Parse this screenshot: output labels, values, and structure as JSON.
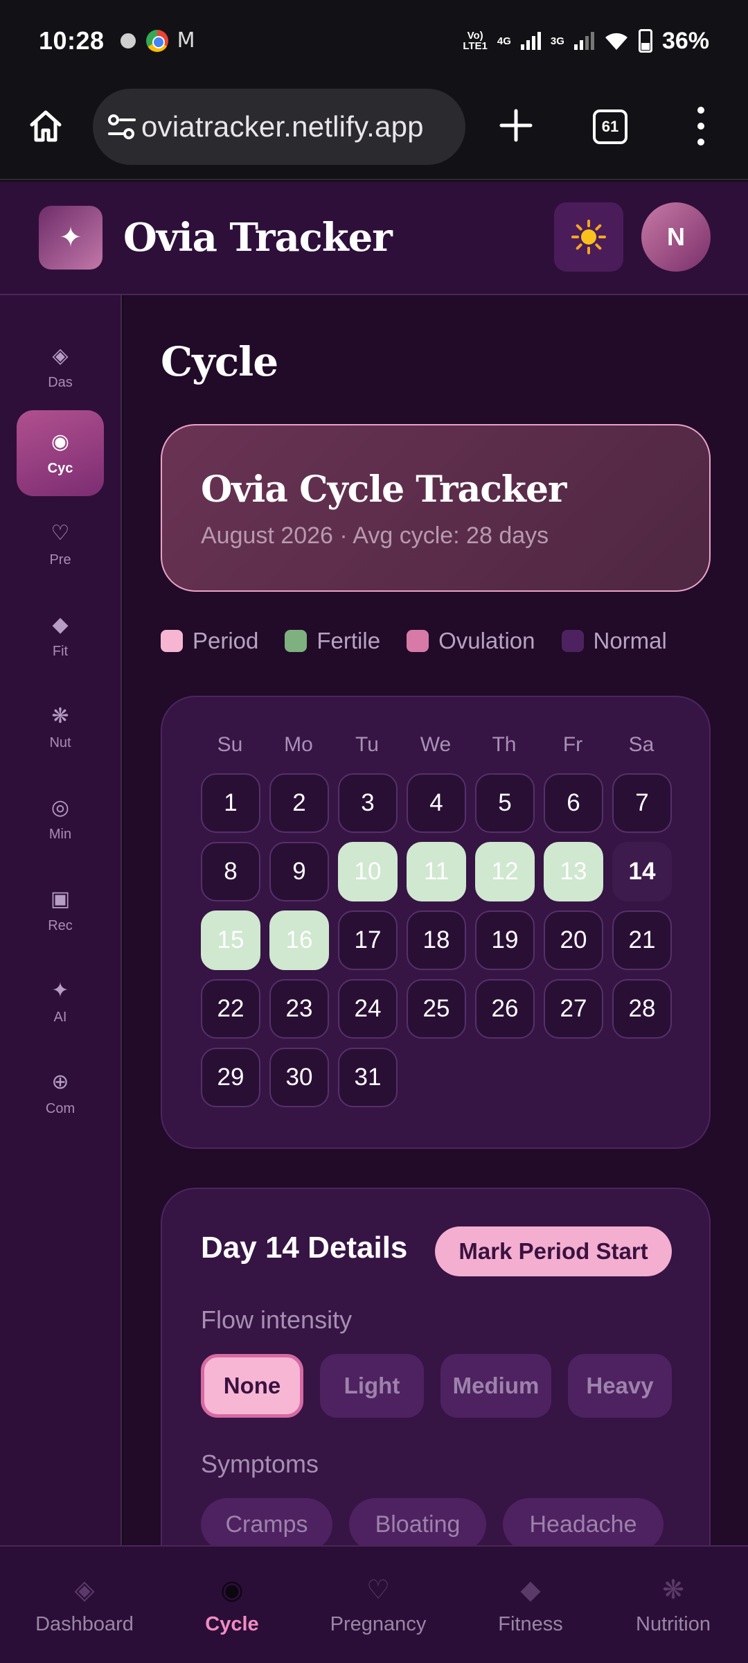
{
  "status_bar": {
    "time": "10:28",
    "net1": "Vo) LTE1",
    "net1_top": "Vo)",
    "net1_bottom": "LTE1",
    "net2": "4G",
    "net3": "3G",
    "battery": "36%"
  },
  "browser": {
    "url": "oviatracker.netlify.app",
    "tab_count": "61"
  },
  "app": {
    "logo_glyph": "✦",
    "title": "Ovia Tracker",
    "avatar_initial": "N"
  },
  "sidebar": {
    "items": [
      {
        "label": "Das",
        "icon": "◈"
      },
      {
        "label": "Cyc",
        "icon": "◉"
      },
      {
        "label": "Pre",
        "icon": "♡"
      },
      {
        "label": "Fit",
        "icon": "◆"
      },
      {
        "label": "Nut",
        "icon": "❋"
      },
      {
        "label": "Min",
        "icon": "◎"
      },
      {
        "label": "Rec",
        "icon": "▣"
      },
      {
        "label": "AI",
        "icon": "✦"
      },
      {
        "label": "Com",
        "icon": "⊕"
      }
    ]
  },
  "page": {
    "title": "Cycle",
    "hero_title": "Ovia Cycle Tracker",
    "hero_subtitle": "August 2026 · Avg cycle: 28 days"
  },
  "legend": [
    {
      "label": "Period",
      "color": "#f6b6d2"
    },
    {
      "label": "Fertile",
      "color": "#7fb07f"
    },
    {
      "label": "Ovulation",
      "color": "#d77aa8"
    },
    {
      "label": "Normal",
      "color": "#4e2260"
    }
  ],
  "calendar": {
    "weekdays": [
      "Su",
      "Mo",
      "Tu",
      "We",
      "Th",
      "Fr",
      "Sa"
    ],
    "days": [
      "1",
      "2",
      "3",
      "4",
      "5",
      "6",
      "7",
      "8",
      "9",
      "10",
      "11",
      "12",
      "13",
      "14",
      "15",
      "16",
      "17",
      "18",
      "19",
      "20",
      "21",
      "22",
      "23",
      "24",
      "25",
      "26",
      "27",
      "28",
      "29",
      "30",
      "31"
    ],
    "fertile_days": [
      10,
      11,
      12,
      13,
      15,
      16
    ],
    "today": 14,
    "first_weekday_index": 0
  },
  "details": {
    "title": "Day 14 Details",
    "mark_button": "Mark Period Start",
    "flow_label": "Flow intensity",
    "flow_options": [
      "None",
      "Light",
      "Medium",
      "Heavy"
    ],
    "flow_selected": "None",
    "symptoms_label": "Symptoms",
    "symptoms": [
      "Cramps",
      "Bloating",
      "Headache"
    ]
  },
  "bottom_nav": {
    "items": [
      {
        "label": "Dashboard",
        "icon": "◈"
      },
      {
        "label": "Cycle",
        "icon": "◉"
      },
      {
        "label": "Pregnancy",
        "icon": "♡"
      },
      {
        "label": "Fitness",
        "icon": "◆"
      },
      {
        "label": "Nutrition",
        "icon": "❋"
      }
    ],
    "active": "Cycle"
  }
}
